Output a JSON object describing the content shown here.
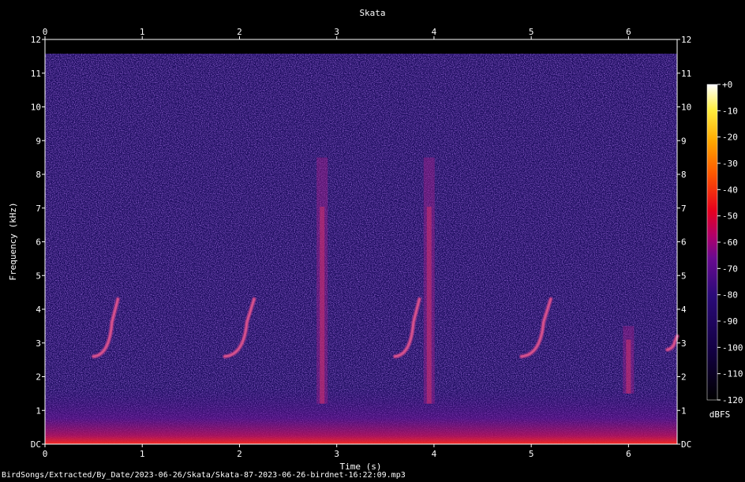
{
  "chart_data": {
    "type": "heatmap",
    "title": "Skata",
    "xlabel": "Time (s)",
    "ylabel": "Frequency (kHz)",
    "xlim": [
      0,
      6.5
    ],
    "ylim": [
      0,
      12
    ],
    "x_ticks": [
      "0",
      "1",
      "2",
      "3",
      "4",
      "5",
      "6"
    ],
    "y_ticks": [
      "DC",
      "1",
      "2",
      "3",
      "4",
      "5",
      "6",
      "7",
      "8",
      "9",
      "10",
      "11",
      "12"
    ],
    "colorbar": {
      "label": "dBFS",
      "range": [
        -120,
        0
      ],
      "ticks": [
        "+0",
        "-10",
        "-20",
        "-30",
        "-40",
        "-50",
        "-60",
        "-70",
        "-80",
        "-90",
        "-100",
        "-110",
        "-120"
      ]
    },
    "calls": [
      {
        "t_start": 0.5,
        "t_end": 0.75,
        "f_low": 2.6,
        "f_high": 4.3
      },
      {
        "t_start": 1.85,
        "t_end": 2.15,
        "f_low": 2.6,
        "f_high": 4.3
      },
      {
        "t_start": 3.6,
        "t_end": 3.85,
        "f_low": 2.6,
        "f_high": 4.3
      },
      {
        "t_start": 4.9,
        "t_end": 5.2,
        "f_low": 2.6,
        "f_high": 4.3
      },
      {
        "t_start": 6.4,
        "t_end": 6.5,
        "f_low": 2.8,
        "f_high": 3.2
      }
    ],
    "broadband_events": [
      {
        "t": 2.85,
        "f_low": 1.2,
        "f_high": 8.5
      },
      {
        "t": 3.95,
        "f_low": 1.2,
        "f_high": 8.5
      },
      {
        "t": 6.0,
        "f_low": 1.5,
        "f_high": 3.5
      }
    ]
  },
  "caption": "BirdSongs/Extracted/By_Date/2023-06-26/Skata/Skata-87-2023-06-26-birdnet-16:22:09.mp3",
  "colors": {
    "background": "#000000",
    "noise": "#1c0c5e",
    "axis": "#ffffff"
  }
}
